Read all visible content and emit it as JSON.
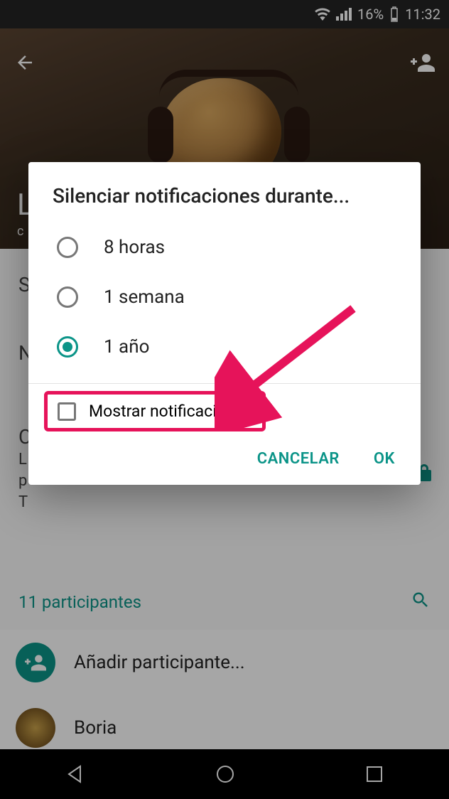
{
  "status": {
    "battery_pct": "16%",
    "time": "11:32"
  },
  "header": {
    "group_title": "ListenToThis/",
    "subtitle": "c"
  },
  "dialog": {
    "title": "Silenciar notificaciones durante...",
    "options": [
      {
        "label": "8 horas",
        "selected": false
      },
      {
        "label": "1 semana",
        "selected": false
      },
      {
        "label": "1 año",
        "selected": true
      }
    ],
    "checkbox_label": "Mostrar notificaciones",
    "cancel_label": "CANCELAR",
    "ok_label": "OK"
  },
  "bg": {
    "letters": {
      "s": "S",
      "n": "N",
      "c": "C",
      "l": "L",
      "p": "p",
      "t": "T"
    },
    "participants_label": "11 participantes",
    "add_participant_label": "Añadir participante...",
    "member_name": "Boria"
  },
  "annotation_color": "#e6135a"
}
